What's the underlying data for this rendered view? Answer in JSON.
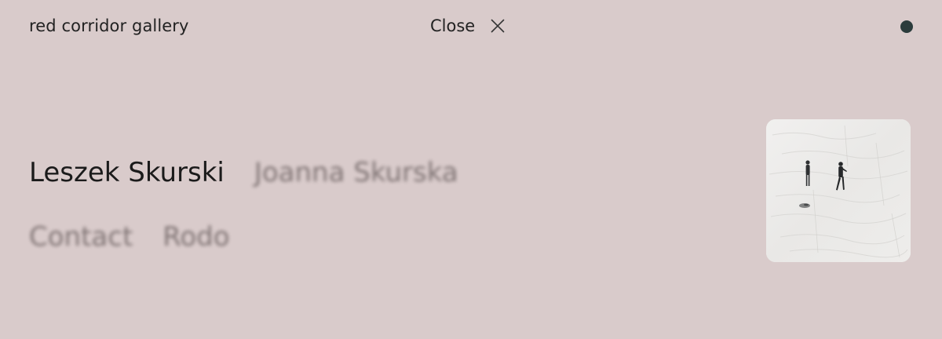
{
  "header": {
    "brand": "red corridor gallery",
    "close_label": "Close",
    "close_icon": "close-x-icon",
    "status_dot_color": "#2b3c3c"
  },
  "menu": {
    "artists": [
      "Leszek Skurski",
      "Joanna Skurska"
    ],
    "links": [
      "Contact",
      "Rodo"
    ]
  },
  "preview": {
    "thumbnail": "painting-two-figures-in-snow"
  },
  "colors": {
    "background": "#d9cbcb",
    "text": "#1b1b1b",
    "muted": "#6f6464"
  }
}
